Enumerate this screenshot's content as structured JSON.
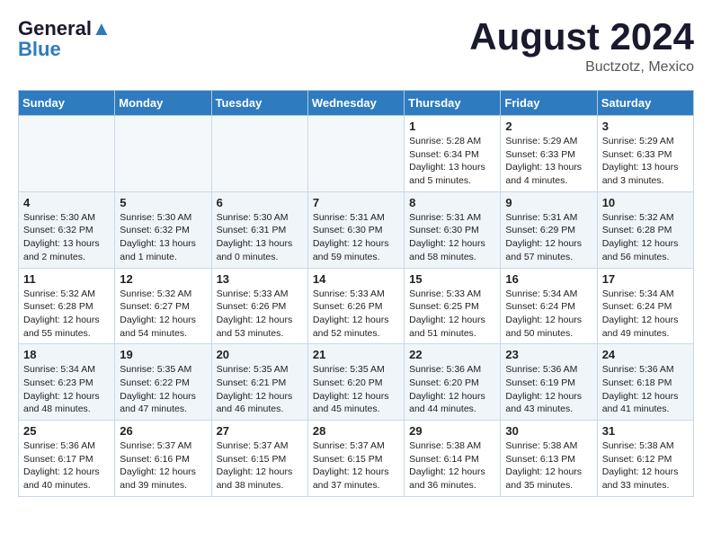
{
  "header": {
    "logo_line1": "General",
    "logo_line2": "Blue",
    "month": "August 2024",
    "location": "Buctzotz, Mexico"
  },
  "weekdays": [
    "Sunday",
    "Monday",
    "Tuesday",
    "Wednesday",
    "Thursday",
    "Friday",
    "Saturday"
  ],
  "weeks": [
    [
      {
        "day": "",
        "info": ""
      },
      {
        "day": "",
        "info": ""
      },
      {
        "day": "",
        "info": ""
      },
      {
        "day": "",
        "info": ""
      },
      {
        "day": "1",
        "info": "Sunrise: 5:28 AM\nSunset: 6:34 PM\nDaylight: 13 hours\nand 5 minutes."
      },
      {
        "day": "2",
        "info": "Sunrise: 5:29 AM\nSunset: 6:33 PM\nDaylight: 13 hours\nand 4 minutes."
      },
      {
        "day": "3",
        "info": "Sunrise: 5:29 AM\nSunset: 6:33 PM\nDaylight: 13 hours\nand 3 minutes."
      }
    ],
    [
      {
        "day": "4",
        "info": "Sunrise: 5:30 AM\nSunset: 6:32 PM\nDaylight: 13 hours\nand 2 minutes."
      },
      {
        "day": "5",
        "info": "Sunrise: 5:30 AM\nSunset: 6:32 PM\nDaylight: 13 hours\nand 1 minute."
      },
      {
        "day": "6",
        "info": "Sunrise: 5:30 AM\nSunset: 6:31 PM\nDaylight: 13 hours\nand 0 minutes."
      },
      {
        "day": "7",
        "info": "Sunrise: 5:31 AM\nSunset: 6:30 PM\nDaylight: 12 hours\nand 59 minutes."
      },
      {
        "day": "8",
        "info": "Sunrise: 5:31 AM\nSunset: 6:30 PM\nDaylight: 12 hours\nand 58 minutes."
      },
      {
        "day": "9",
        "info": "Sunrise: 5:31 AM\nSunset: 6:29 PM\nDaylight: 12 hours\nand 57 minutes."
      },
      {
        "day": "10",
        "info": "Sunrise: 5:32 AM\nSunset: 6:28 PM\nDaylight: 12 hours\nand 56 minutes."
      }
    ],
    [
      {
        "day": "11",
        "info": "Sunrise: 5:32 AM\nSunset: 6:28 PM\nDaylight: 12 hours\nand 55 minutes."
      },
      {
        "day": "12",
        "info": "Sunrise: 5:32 AM\nSunset: 6:27 PM\nDaylight: 12 hours\nand 54 minutes."
      },
      {
        "day": "13",
        "info": "Sunrise: 5:33 AM\nSunset: 6:26 PM\nDaylight: 12 hours\nand 53 minutes."
      },
      {
        "day": "14",
        "info": "Sunrise: 5:33 AM\nSunset: 6:26 PM\nDaylight: 12 hours\nand 52 minutes."
      },
      {
        "day": "15",
        "info": "Sunrise: 5:33 AM\nSunset: 6:25 PM\nDaylight: 12 hours\nand 51 minutes."
      },
      {
        "day": "16",
        "info": "Sunrise: 5:34 AM\nSunset: 6:24 PM\nDaylight: 12 hours\nand 50 minutes."
      },
      {
        "day": "17",
        "info": "Sunrise: 5:34 AM\nSunset: 6:24 PM\nDaylight: 12 hours\nand 49 minutes."
      }
    ],
    [
      {
        "day": "18",
        "info": "Sunrise: 5:34 AM\nSunset: 6:23 PM\nDaylight: 12 hours\nand 48 minutes."
      },
      {
        "day": "19",
        "info": "Sunrise: 5:35 AM\nSunset: 6:22 PM\nDaylight: 12 hours\nand 47 minutes."
      },
      {
        "day": "20",
        "info": "Sunrise: 5:35 AM\nSunset: 6:21 PM\nDaylight: 12 hours\nand 46 minutes."
      },
      {
        "day": "21",
        "info": "Sunrise: 5:35 AM\nSunset: 6:20 PM\nDaylight: 12 hours\nand 45 minutes."
      },
      {
        "day": "22",
        "info": "Sunrise: 5:36 AM\nSunset: 6:20 PM\nDaylight: 12 hours\nand 44 minutes."
      },
      {
        "day": "23",
        "info": "Sunrise: 5:36 AM\nSunset: 6:19 PM\nDaylight: 12 hours\nand 43 minutes."
      },
      {
        "day": "24",
        "info": "Sunrise: 5:36 AM\nSunset: 6:18 PM\nDaylight: 12 hours\nand 41 minutes."
      }
    ],
    [
      {
        "day": "25",
        "info": "Sunrise: 5:36 AM\nSunset: 6:17 PM\nDaylight: 12 hours\nand 40 minutes."
      },
      {
        "day": "26",
        "info": "Sunrise: 5:37 AM\nSunset: 6:16 PM\nDaylight: 12 hours\nand 39 minutes."
      },
      {
        "day": "27",
        "info": "Sunrise: 5:37 AM\nSunset: 6:15 PM\nDaylight: 12 hours\nand 38 minutes."
      },
      {
        "day": "28",
        "info": "Sunrise: 5:37 AM\nSunset: 6:15 PM\nDaylight: 12 hours\nand 37 minutes."
      },
      {
        "day": "29",
        "info": "Sunrise: 5:38 AM\nSunset: 6:14 PM\nDaylight: 12 hours\nand 36 minutes."
      },
      {
        "day": "30",
        "info": "Sunrise: 5:38 AM\nSunset: 6:13 PM\nDaylight: 12 hours\nand 35 minutes."
      },
      {
        "day": "31",
        "info": "Sunrise: 5:38 AM\nSunset: 6:12 PM\nDaylight: 12 hours\nand 33 minutes."
      }
    ]
  ]
}
